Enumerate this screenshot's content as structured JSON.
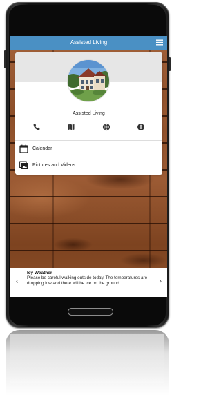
{
  "app": {
    "title": "Assisted Living",
    "accent_color": "#4a90c4",
    "menu_icon": "hamburger-menu-icon"
  },
  "profile": {
    "name": "Assisted Living",
    "avatar": "building-photo",
    "contact_icons": [
      "phone-icon",
      "map-icon",
      "globe-icon",
      "info-icon"
    ]
  },
  "links": [
    {
      "label": "Calendar",
      "icon": "calendar-icon"
    },
    {
      "label": "Pictures and Videos",
      "icon": "photo-icon"
    }
  ],
  "notification": {
    "title": "Icy Weather",
    "body": "Please be careful walking outside today. The temperatures are dropping low and there will be ice on the ground.",
    "prev_glyph": "‹",
    "next_glyph": "›"
  }
}
